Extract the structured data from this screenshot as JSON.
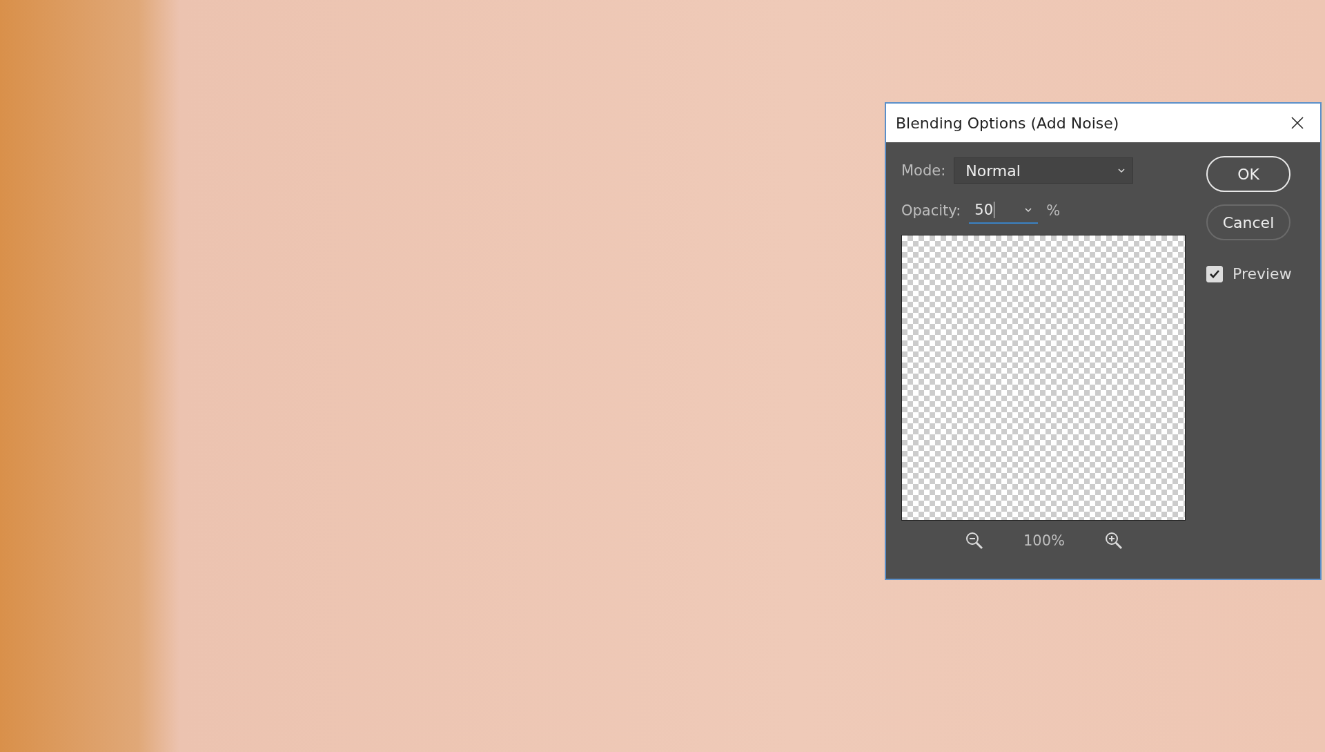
{
  "dialog": {
    "title": "Blending Options (Add Noise)"
  },
  "mode": {
    "label": "Mode:",
    "value": "Normal"
  },
  "opacity": {
    "label": "Opacity:",
    "value": "50",
    "unit": "%"
  },
  "buttons": [
    {
      "label": "OK",
      "kind": "default"
    },
    {
      "label": "Cancel",
      "kind": "normal"
    }
  ],
  "preview": {
    "label": "Preview",
    "checked": true
  },
  "zoom": {
    "value": "100%"
  }
}
